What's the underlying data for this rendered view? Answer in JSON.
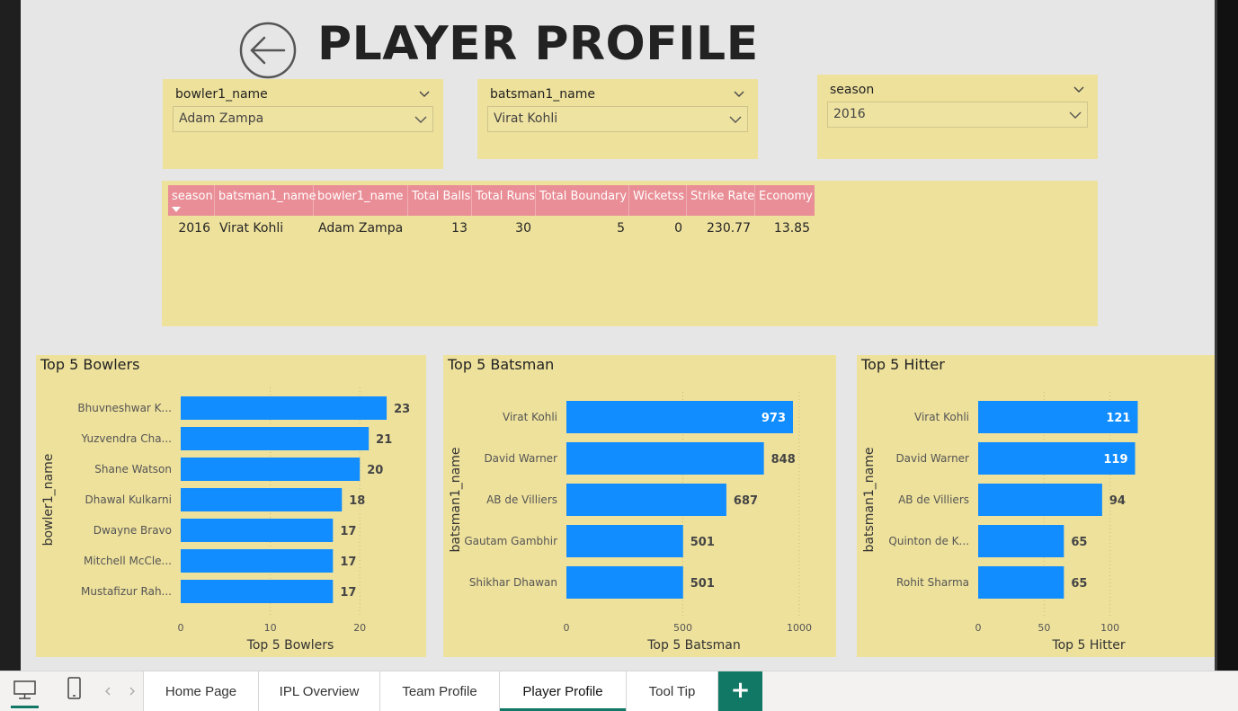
{
  "page": {
    "title": "PLAYER PROFILE"
  },
  "slicers": [
    {
      "field": "bowler1_name",
      "value": "Adam Zampa"
    },
    {
      "field": "batsman1_name",
      "value": "Virat Kohli"
    },
    {
      "field": "season",
      "value": "2016"
    }
  ],
  "table": {
    "columns": [
      "season",
      "batsman1_name",
      "bowler1_name",
      "Total Balls",
      "Total Runs",
      "Total Boundary",
      "Wicketss",
      "Strike Rate",
      "Economy"
    ],
    "rows": [
      [
        "2016",
        "Virat Kohli",
        "Adam Zampa",
        "13",
        "30",
        "5",
        "0",
        "230.77",
        "13.85"
      ]
    ]
  },
  "colors": {
    "bar": "#118dff",
    "panel": "#eee19c",
    "table_header": "#e98e96",
    "accent": "#117865"
  },
  "chart_data": [
    {
      "type": "bar",
      "orientation": "horizontal",
      "title": "Top 5 Bowlers",
      "xlabel": "Top 5 Bowlers",
      "ylabel": "bowler1_name",
      "categories": [
        "Bhuvneshwar K...",
        "Yuzvendra Cha...",
        "Shane Watson",
        "Dhawal Kulkarni",
        "Dwayne Bravo",
        "Mitchell McCle...",
        "Mustafizur Rah..."
      ],
      "values": [
        23,
        21,
        20,
        18,
        17,
        17,
        17
      ],
      "xlim": [
        0,
        25
      ],
      "xticks": [
        0,
        10,
        20
      ],
      "grid": true
    },
    {
      "type": "bar",
      "orientation": "horizontal",
      "title": "Top 5 Batsman",
      "xlabel": "Top 5 Batsman",
      "ylabel": "batsman1_name",
      "categories": [
        "Virat Kohli",
        "David Warner",
        "AB de Villiers",
        "Gautam Gambhir",
        "Shikhar Dhawan"
      ],
      "values": [
        973,
        848,
        687,
        501,
        501
      ],
      "xlim": [
        0,
        1000
      ],
      "xticks": [
        0,
        500,
        1000
      ],
      "grid": true
    },
    {
      "type": "bar",
      "orientation": "horizontal",
      "title": "Top 5 Hitter",
      "xlabel": "Top 5 Hitter",
      "ylabel": "batsman1_name",
      "categories": [
        "Virat Kohli",
        "David Warner",
        "AB de Villiers",
        "Quinton de K...",
        "Rohit Sharma"
      ],
      "values": [
        121,
        119,
        94,
        65,
        65
      ],
      "xlim": [
        0,
        120
      ],
      "xticks": [
        0,
        50,
        100
      ],
      "grid": true
    }
  ],
  "tabs": {
    "items": [
      "Home Page",
      "IPL Overview",
      "Team Profile",
      "Player Profile",
      "Tool Tip"
    ],
    "active": "Player Profile",
    "add_label": "+"
  },
  "icons": {
    "back": "back-arrow-icon",
    "desktop": "desktop-icon",
    "phone": "phone-icon",
    "prev": "chevron-left-icon",
    "next": "chevron-right-icon"
  }
}
